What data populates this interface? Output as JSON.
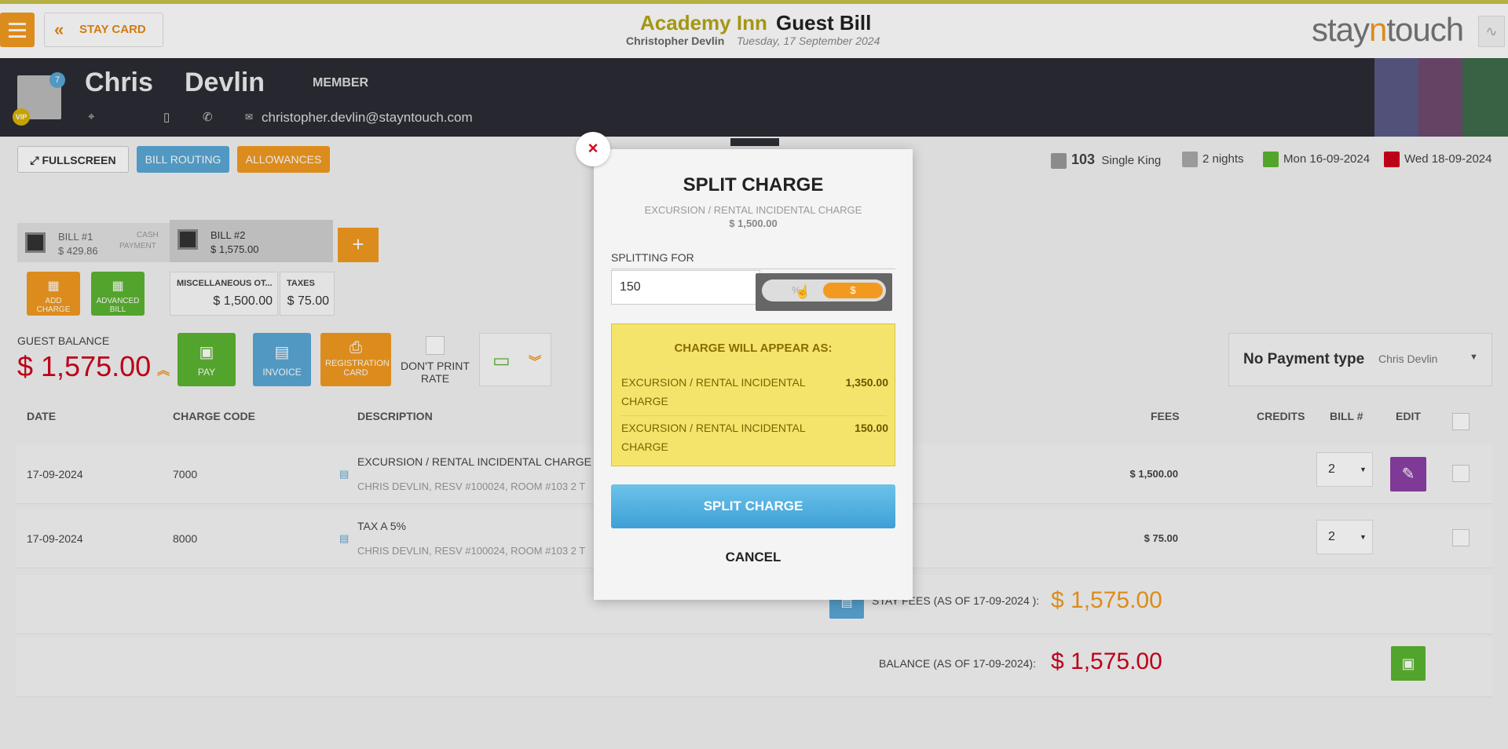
{
  "header": {
    "stay_card_label": "STAY CARD",
    "hotel_name": "Academy Inn",
    "bill_title": "Guest Bill",
    "guest_name": "Christopher Devlin",
    "date": "Tuesday, 17 September 2024",
    "logo_a": "stay",
    "logo_b": "n",
    "logo_c": "touch"
  },
  "guest": {
    "first_name": "Chris",
    "last_name": "Devlin",
    "member_label": "MEMBER",
    "email": "christopher.devlin@stayntouch.com",
    "notification_count": "7",
    "vip_label": "VIP"
  },
  "actions": {
    "fullscreen": "FULLSCREEN",
    "bill_routing": "BILL ROUTING",
    "allowances": "ALLOWANCES"
  },
  "stay_info": {
    "room_number": "103",
    "room_type": "Single King",
    "nights": "2 nights",
    "arrival": "Mon 16-09-2024",
    "departure": "Wed 18-09-2024"
  },
  "bills": [
    {
      "label": "BILL #1",
      "amount": "$ 429.86",
      "note_line1": "CASH",
      "note_line2": "PAYMENT"
    },
    {
      "label": "BILL #2",
      "amount": "$ 1,575.00"
    }
  ],
  "add_bill_label": "+",
  "tiles": {
    "add_charge": "ADD CHARGE",
    "advanced_bill": "ADVANCED BILL",
    "pay": "PAY",
    "invoice": "INVOICE",
    "registration_card": "REGISTRATION CARD"
  },
  "subtotals": [
    {
      "label": "MISCELLANEOUS OT...",
      "amount": "$ 1,500.00"
    },
    {
      "label": "TAXES",
      "amount": "$ 75.00"
    }
  ],
  "guest_balance": {
    "label": "GUEST BALANCE",
    "amount": "$ 1,575.00"
  },
  "dont_print_rate": "DON'T PRINT RATE",
  "payment": {
    "type": "No Payment type",
    "payer": "Chris Devlin"
  },
  "table": {
    "headers": {
      "date": "DATE",
      "charge_code": "CHARGE CODE",
      "description": "DESCRIPTION",
      "fees": "FEES",
      "credits": "CREDITS",
      "bill_no": "BILL #",
      "edit": "EDIT"
    },
    "rows": [
      {
        "date": "17-09-2024",
        "code": "7000",
        "desc": "EXCURSION / RENTAL INCIDENTAL CHARGE",
        "sub": "CHRIS DEVLIN, RESV #100024, ROOM #103 2 T",
        "fees": "$ 1,500.00",
        "bill": "2"
      },
      {
        "date": "17-09-2024",
        "code": "8000",
        "desc": "TAX A 5%",
        "sub": "CHRIS DEVLIN, RESV #100024, ROOM #103 2 T",
        "fees": "$ 75.00",
        "bill": "2"
      }
    ],
    "stay_fees_label": "STAY FEES (AS OF  17-09-2024 ):",
    "stay_fees_amount": "$ 1,575.00",
    "balance_label": "BALANCE (AS OF  17-09-2024):",
    "balance_amount": "$ 1,575.00"
  },
  "modal": {
    "close": "×",
    "title": "SPLIT CHARGE",
    "charge_name": "EXCURSION / RENTAL INCIDENTAL CHARGE",
    "charge_amount": "$ 1,500.00",
    "splitting_for_label": "SPLITTING FOR",
    "splitting_value": "150",
    "toggle_percent": "%",
    "toggle_dollar": "$",
    "appear_heading": "CHARGE WILL APPEAR AS:",
    "lines": [
      {
        "desc": "EXCURSION / RENTAL INCIDENTAL CHARGE",
        "amount": "1,350.00"
      },
      {
        "desc": "EXCURSION / RENTAL INCIDENTAL CHARGE",
        "amount": "150.00"
      }
    ],
    "split_button": "SPLIT CHARGE",
    "cancel_button": "CANCEL"
  },
  "colors": {
    "accent_orange": "#f29a1f",
    "balance_red": "#d0021b",
    "blue": "#3e9fd6",
    "green": "#5cb531"
  }
}
